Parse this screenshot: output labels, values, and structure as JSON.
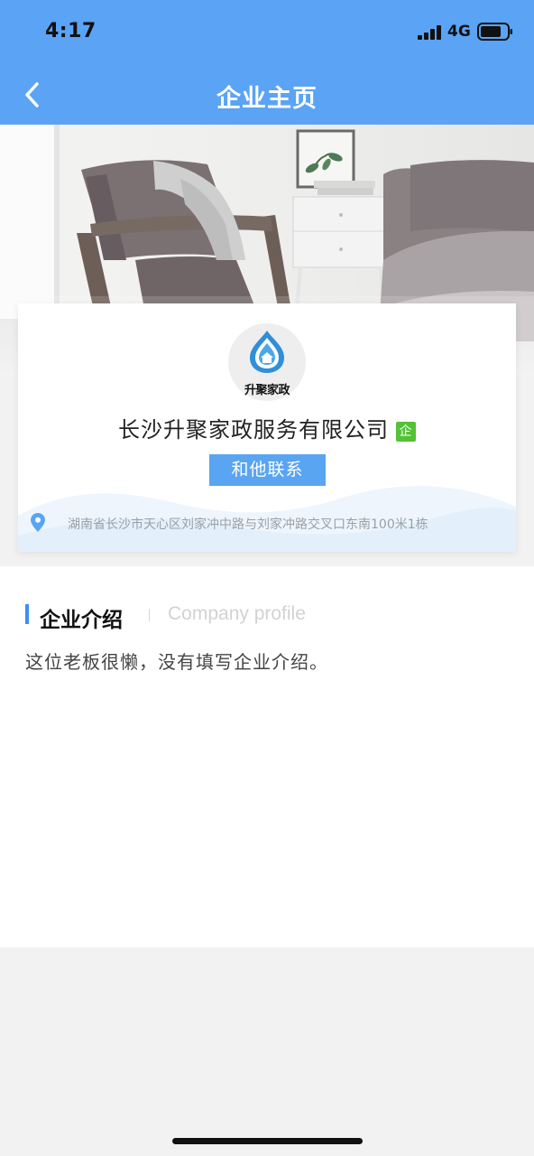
{
  "status_bar": {
    "time": "4:17",
    "network": "4G"
  },
  "nav": {
    "title": "企业主页"
  },
  "company": {
    "logo_text": "升聚家政",
    "name": "长沙升聚家政服务有限公司",
    "badge": "企",
    "contact_button": "和他联系",
    "address": "湖南省长沙市天心区刘家冲中路与刘家冲路交叉口东南100米1栋"
  },
  "profile": {
    "title": "企业介绍",
    "subtitle": "Company profile",
    "intro": "这位老板很懒，没有填写企业介绍。"
  },
  "colors": {
    "header": "#5ba3f5",
    "button": "#5aa5f2",
    "badge": "#54c236",
    "accent": "#3d8ef0"
  }
}
